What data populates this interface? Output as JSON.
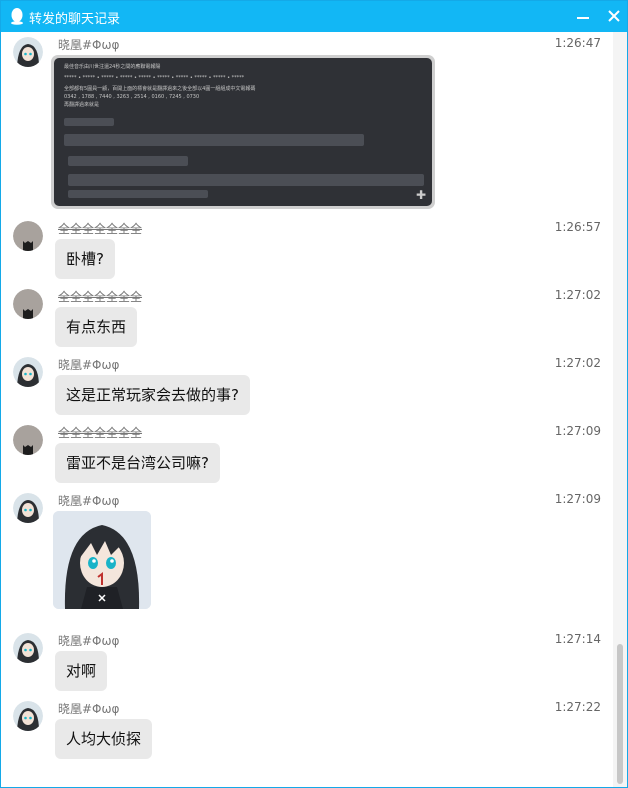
{
  "window": {
    "title": "转发的聊天记录",
    "colors": {
      "titlebar": "#12b7f5",
      "bubble": "#e9e9e9"
    },
    "icons": {
      "app": "qq-penguin-icon",
      "minimize": "minimize-icon",
      "close": "close-icon"
    }
  },
  "screenshot_image": {
    "lines": [
      "最佳音乐由川世注還24秒之間的應聯電報陽",
      "***** • ***** • ***** • ***** • ***** • ***** • ***** • ***** • ***** • *****",
      "全部都有5圓員一顧，百開上面的標會就是翻譯過來之後全部以4圓一組組成中文電報碼",
      "0342 , 1788 , 7440 , 3263 , 2514 , 0160 , 7245 , 0730",
      "再翻譯過來就是"
    ]
  },
  "messages": [
    {
      "nick": "晓凰#Φωφ",
      "time": "1:26:47",
      "type": "image",
      "avatar": "anime-avatar"
    },
    {
      "nick": "全全全全全全全",
      "time": "1:26:57",
      "text": "卧槽?",
      "avatar": "cat-avatar"
    },
    {
      "nick": "全全全全全全全",
      "time": "1:27:02",
      "text": "有点东西",
      "avatar": "cat-avatar"
    },
    {
      "nick": "晓凰#Φωφ",
      "time": "1:27:02",
      "text": "这是正常玩家会去做的事?",
      "avatar": "anime-avatar"
    },
    {
      "nick": "全全全全全全全",
      "time": "1:27:09",
      "text": "雷亚不是台湾公司嘛?",
      "avatar": "cat-avatar"
    },
    {
      "nick": "晓凰#Φωφ",
      "time": "1:27:09",
      "type": "sticker",
      "avatar": "anime-avatar"
    },
    {
      "nick": "晓凰#Φωφ",
      "time": "1:27:14",
      "text": "对啊",
      "avatar": "anime-avatar"
    },
    {
      "nick": "晓凰#Φωφ",
      "time": "1:27:22",
      "text": "人均大侦探",
      "avatar": "anime-avatar"
    }
  ]
}
